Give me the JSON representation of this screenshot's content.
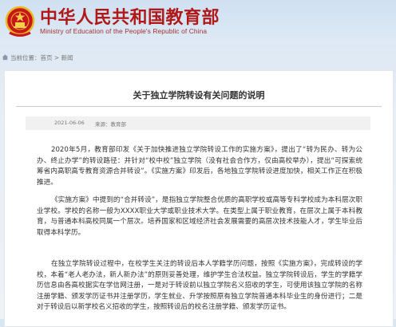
{
  "header": {
    "title": "中华人民共和国教育部",
    "subtitle": "Ministry of Education of the People's Republic of China"
  },
  "breadcrumb": {
    "label": "当前位置：",
    "items": [
      "首页",
      "新闻"
    ],
    "separator": " > "
  },
  "article": {
    "title": "关于独立学院转设有关问题的说明",
    "date": "2021-06-06",
    "source": "来源：教育部",
    "paragraphs": [
      "2020年5月，教育部印发《关于加快推进独立学院转设工作的实施方案》，提出了“转为民办、转为公办、终止办学”的转设路径：并针对“校中校”独立学院（没有社会合作方，仅由高校举办），提出“可探索统筹省内高职高专教育资源合并转设”。《实施方案》印发后，各地独立学院转设进度加快，相关工作正在积极推进。",
      "《实施方案》中提到的“合并转设”，是指独立学院整合优质的高职学校或高等专科学校成为本科层次职业学校。学校的名称一般为XXXX职业大学或职业技术大学。在类型上属于职业教育，在层次上属于本科教育，与普通本科高校同属一个层次。培养国家和区域经济社会发展需要的高层次技术技能人才，学生毕业后取得本科学历。",
      "在独立学院转设过程中，在校学生关注的转设后本人学籍学历问题，按照《实施方案》，完成转设的学校，本着“老人老办法，新人新办法”的原则妥善处理，维护学生合法权益。独立学院转设后，学生的学籍学历信息由各高校据实在学信网注册，一是对于转设前以独立学院名义招收的学生，可使用该独立学院的名称注册学籍、颁发学历证书并注册学历，学生就业、升学按照原有独立学院普通本科毕业生的身份进行；二是对于转设后以新学校名义招收的学生，按照转设后的校名注册学籍、颁发学历证书。"
    ]
  },
  "colors": {
    "title_red": "#b01919",
    "banner_blue": "#cfe0f1",
    "panel_white": "#ffffff"
  },
  "icons": [
    "national-emblem-icon",
    "home-icon"
  ]
}
